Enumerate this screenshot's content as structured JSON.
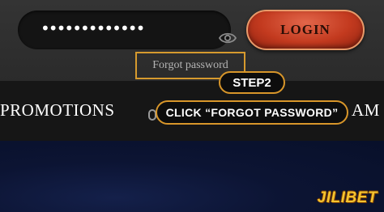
{
  "login_form": {
    "password_masked": "•••••••••••••",
    "login_label": "LOGIN",
    "forgot_password_label": "Forgot password"
  },
  "nav": {
    "items": [
      {
        "label": "PROMOTIONS"
      },
      {
        "label": "AM"
      }
    ]
  },
  "tutorial": {
    "step_label": "STEP2",
    "callout": "CLICK “FORGOT PASSWORD”"
  },
  "brand": {
    "logo_text": "JILIBET"
  },
  "colors": {
    "accent_gold": "#d8962a",
    "login_red": "#c33a1f",
    "content_navy": "#0c1433"
  },
  "icons": [
    "eye-icon"
  ]
}
